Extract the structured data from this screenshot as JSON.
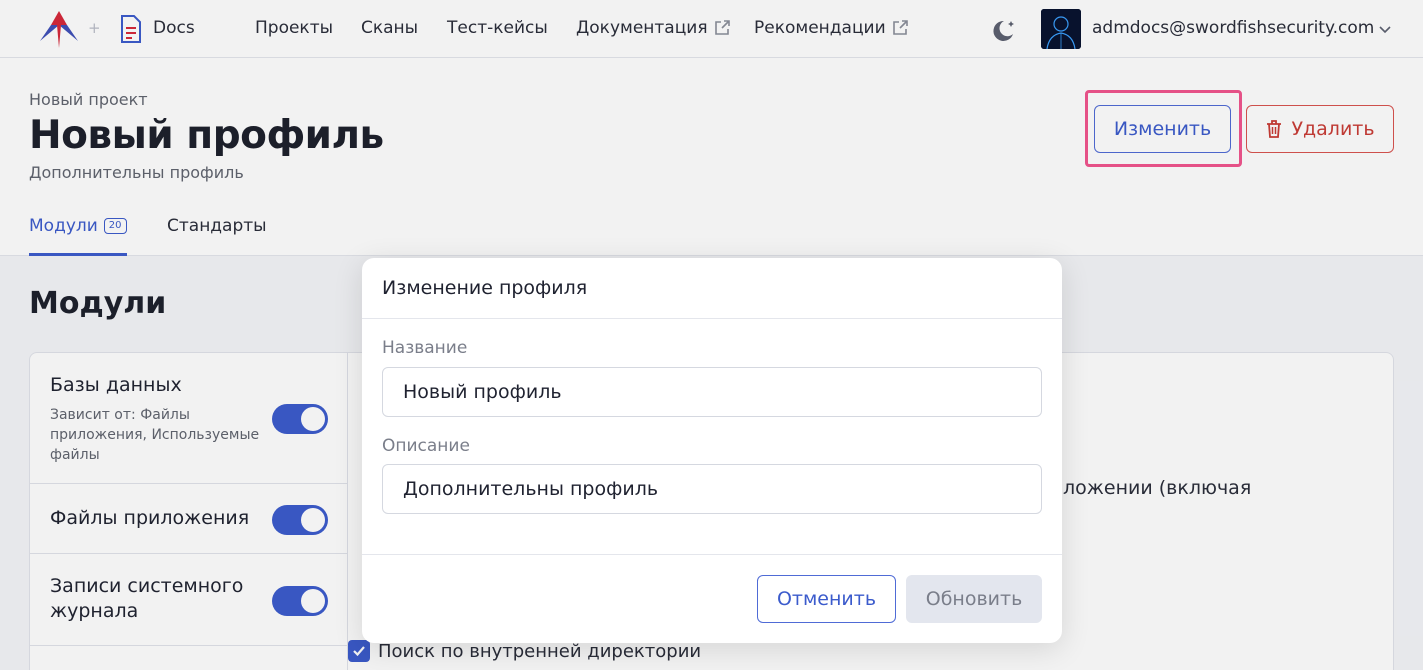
{
  "app": {
    "docs_label": "Docs"
  },
  "nav": {
    "projects": "Проекты",
    "scans": "Сканы",
    "test_cases": "Тест-кейсы",
    "documentation": "Документация",
    "recommendations": "Рекомендации"
  },
  "user": {
    "email": "admdocs@swordfishsecurity.com"
  },
  "header": {
    "breadcrumb": "Новый проект",
    "title": "Новый профиль",
    "subtitle": "Дополнительны профиль",
    "edit_label": "Изменить",
    "delete_label": "Удалить"
  },
  "tabs": {
    "modules_label": "Модули",
    "modules_count": "20",
    "standards_label": "Стандарты"
  },
  "content": {
    "section_title": "Модули",
    "modules": [
      {
        "name": "Базы данных",
        "depends": "Зависит от: Файлы приложения, Используемые файлы",
        "enabled": true
      },
      {
        "name": "Файлы приложения",
        "enabled": true
      },
      {
        "name": "Записи системного журнала",
        "enabled": true
      }
    ],
    "detail_fragment": "ложении (включая",
    "checkbox_label": "Поиск по внутренней директории",
    "checkbox_checked": true
  },
  "dialog": {
    "title": "Изменение профиля",
    "name_label": "Название",
    "name_value": "Новый профиль",
    "description_label": "Описание",
    "description_value": "Дополнительны профиль",
    "cancel_label": "Отменить",
    "update_label": "Обновить"
  },
  "colors": {
    "accent": "#3b5bcc",
    "danger": "#c93b35",
    "highlight": "#f2548e"
  }
}
